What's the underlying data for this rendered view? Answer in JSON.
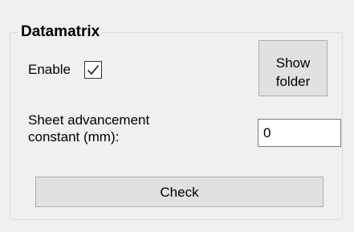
{
  "groupbox": {
    "title": "Datamatrix"
  },
  "enable": {
    "label": "Enable",
    "checked": true
  },
  "show_folder_button": {
    "line1": "Show",
    "line2": "folder"
  },
  "sheet_advancement": {
    "label_line1": "Sheet advancement",
    "label_line2": "constant (mm):",
    "value": "0"
  },
  "check_button": {
    "label": "Check"
  }
}
